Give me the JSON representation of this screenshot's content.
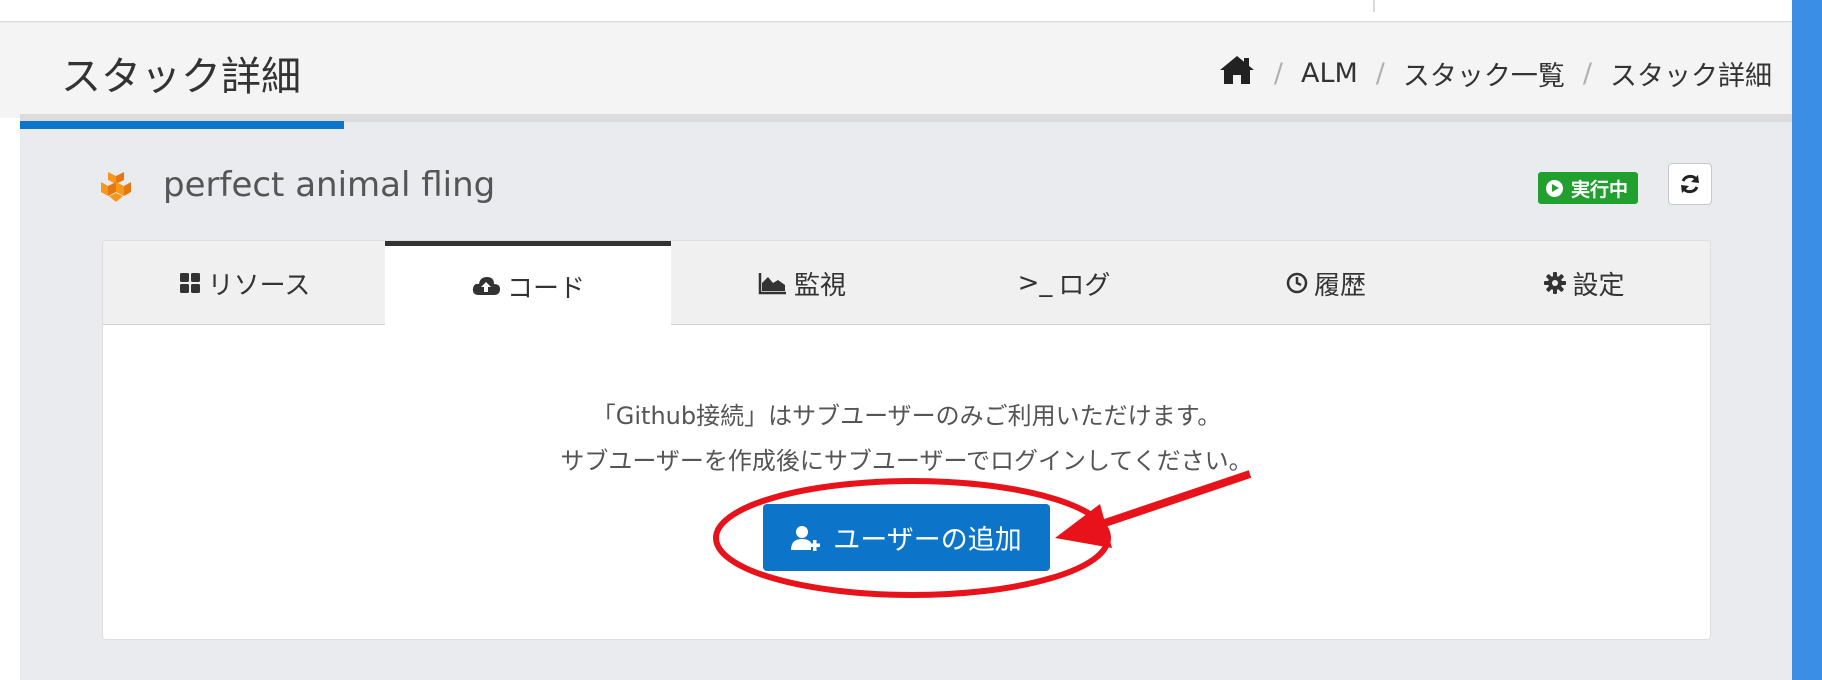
{
  "header": {
    "title": "スタック詳細",
    "breadcrumb": [
      {
        "label": "ALM"
      },
      {
        "label": "スタック一覧"
      },
      {
        "label": "スタック詳細"
      }
    ],
    "breadcrumb_separator": "/",
    "home_icon": "home-icon"
  },
  "stack": {
    "name": "perfect animal fling",
    "icon": "aws-cube-icon",
    "status": "実行中",
    "status_color": "#21a030",
    "refresh_icon": "refresh-icon"
  },
  "tabs": [
    {
      "label": "リソース",
      "icon": "grid-icon"
    },
    {
      "label": "コード",
      "icon": "cloud-upload-icon",
      "active": true
    },
    {
      "label": "監視",
      "icon": "area-chart-icon"
    },
    {
      "label": "ログ",
      "icon": "terminal-icon",
      "prefix": ">_"
    },
    {
      "label": "履歴",
      "icon": "clock-icon"
    },
    {
      "label": "設定",
      "icon": "gear-icon"
    }
  ],
  "content": {
    "message_line1": "「Github接続」はサブユーザーのみご利用いただけます。",
    "message_line2": "サブユーザーを作成後にサブユーザーでログインしてください。",
    "add_user_label": "ユーザーの追加",
    "add_user_icon": "user-plus-icon"
  },
  "colors": {
    "accent": "#0d75c9",
    "annotation": "#e8121a",
    "badge": "#21a030"
  }
}
